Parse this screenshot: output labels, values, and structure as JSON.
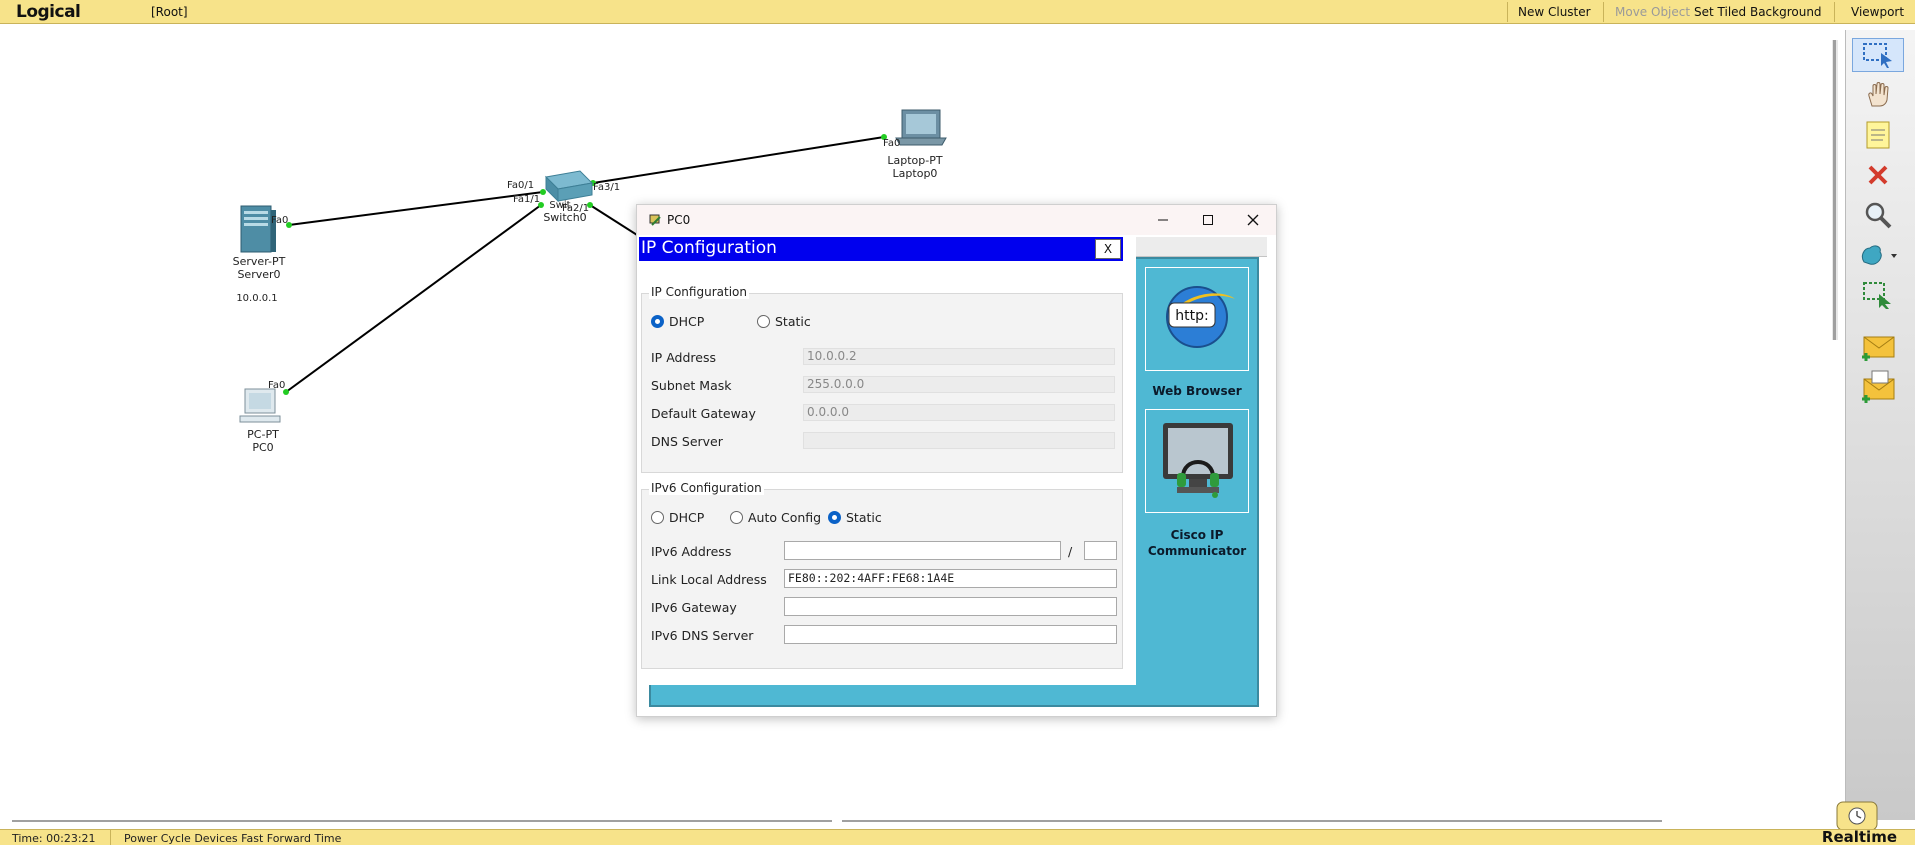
{
  "topbar": {
    "mode": "Logical",
    "root": "[Root]",
    "new_cluster": "New Cluster",
    "move_object": "Move Object",
    "set_tiled_background": "Set Tiled Background",
    "viewport": "Viewport"
  },
  "topology": {
    "devices": [
      {
        "model": "Server-PT",
        "name": "Server0",
        "ip": "10.0.0.1"
      },
      {
        "model": "PC-PT",
        "name": "PC0"
      },
      {
        "model": "Laptop-PT",
        "name": "Laptop0"
      },
      {
        "model": "Switch",
        "name": "Switch0",
        "partial": "Swit"
      }
    ],
    "ports": {
      "server_fa0": "Fa0",
      "pc_fa0": "Fa0",
      "laptop_fa0": "Fa0",
      "sw_fa01": "Fa0/1",
      "sw_fa11": "Fa1/1",
      "sw_fa21": "Fa2/1",
      "sw_fa31": "Fa3/1"
    },
    "link_color": "#000000",
    "port_up_color": "#22cc22"
  },
  "window": {
    "title": "PC0"
  },
  "ip_config": {
    "header": "IP Configuration",
    "close_label": "X",
    "ipv4_group": "IP Configuration",
    "dhcp_label": "DHCP",
    "static_label": "Static",
    "mode_selected": "DHCP",
    "ip_address_label": "IP Address",
    "ip_address": "10.0.0.2",
    "subnet_mask_label": "Subnet Mask",
    "subnet_mask": "255.0.0.0",
    "default_gateway_label": "Default Gateway",
    "default_gateway": "0.0.0.0",
    "dns_server_label": "DNS Server",
    "dns_server": "",
    "ipv6_group": "IPv6 Configuration",
    "ipv6_dhcp_label": "DHCP",
    "ipv6_auto_label": "Auto Config",
    "ipv6_static_label": "Static",
    "ipv6_mode_selected": "Static",
    "ipv6_address_label": "IPv6 Address",
    "ipv6_address": "",
    "ipv6_slash": "/",
    "ipv6_prefix": "",
    "link_local_label": "Link Local Address",
    "link_local": "FE80::202:4AFF:FE68:1A4E",
    "ipv6_gateway_label": "IPv6 Gateway",
    "ipv6_gateway": "",
    "ipv6_dns_label": "IPv6 DNS Server",
    "ipv6_dns": ""
  },
  "desktop_apps": [
    {
      "label": "Web Browser",
      "icon": "web-browser-icon",
      "glyph": "http:"
    },
    {
      "label": "Cisco IP Communicator",
      "icon": "ip-communicator-icon"
    }
  ],
  "statusbar": {
    "time": "Time: 00:23:21",
    "actions": "Power Cycle Devices  Fast Forward Time",
    "mode": "Realtime"
  },
  "colors": {
    "topbar": "#f7e38a",
    "desktop": "#4fb8d3",
    "config_header": "#0000ee",
    "radio_selected": "#0b62c7"
  }
}
